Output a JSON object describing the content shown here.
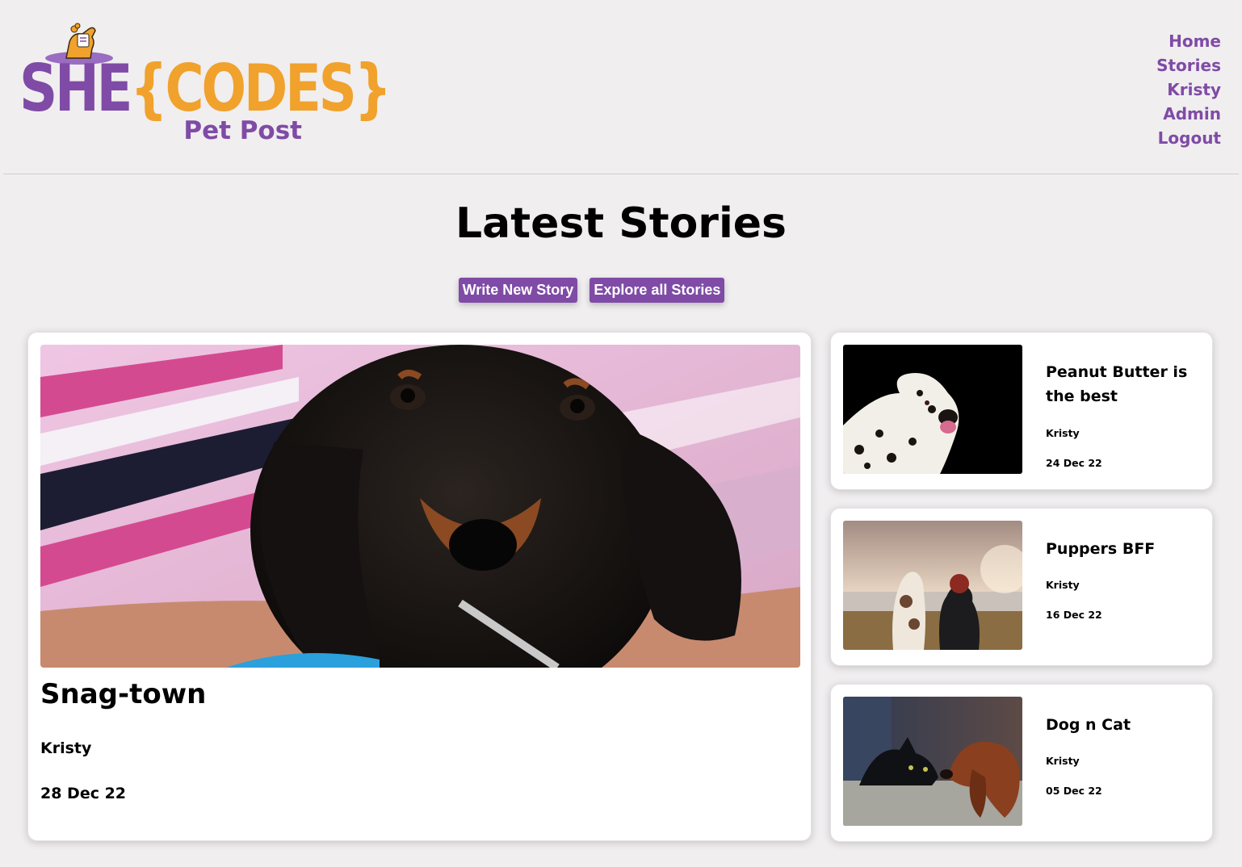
{
  "logo": {
    "word_she": "SHE",
    "word_codes": "{CODES}",
    "subtitle": "Pet Post"
  },
  "nav": {
    "items": [
      {
        "label": "Home"
      },
      {
        "label": "Stories"
      },
      {
        "label": "Kristy"
      },
      {
        "label": "Admin"
      },
      {
        "label": "Logout"
      }
    ]
  },
  "main": {
    "title": "Latest Stories",
    "buttons": {
      "write": "Write New Story",
      "explore": "Explore all Stories"
    },
    "featured": {
      "title": "Snag-town",
      "author": "Kristy",
      "date": "28 Dec 22",
      "image": "dachshund-puppy-photo"
    },
    "stories": [
      {
        "title": "Peanut Butter is the best",
        "author": "Kristy",
        "date": "24 Dec 22",
        "image": "dalmatian-photo"
      },
      {
        "title": "Puppers BFF",
        "author": "Kristy",
        "date": "16 Dec 22",
        "image": "dog-and-person-lake-photo"
      },
      {
        "title": "Dog n Cat",
        "author": "Kristy",
        "date": "05 Dec 22",
        "image": "cat-and-spaniel-photo"
      }
    ]
  },
  "colors": {
    "brand_purple": "#7f4ba6",
    "brand_orange": "#f0a22c",
    "background": "#f0eeef"
  }
}
